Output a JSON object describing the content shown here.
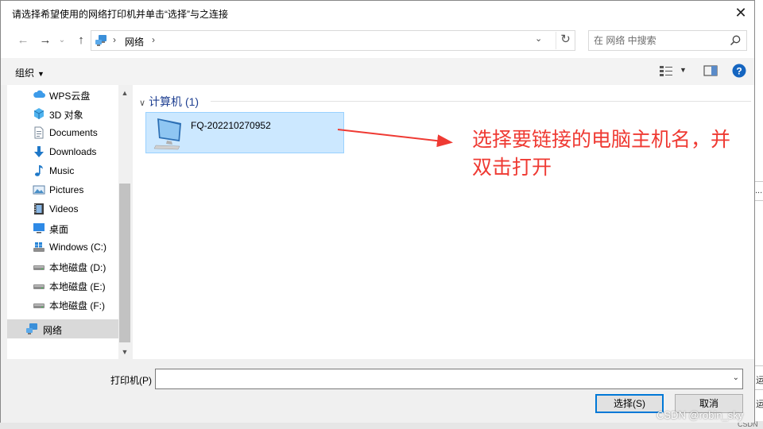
{
  "window": {
    "title": "请选择希望使用的网络打印机并单击“选择”与之连接"
  },
  "address": {
    "crumb": "网络"
  },
  "search": {
    "placeholder": "在 网络 中搜索"
  },
  "toolbar": {
    "organize": "组织"
  },
  "tree": {
    "items": [
      {
        "label": "WPS云盘",
        "icon": "cloud-icon"
      },
      {
        "label": "3D 对象",
        "icon": "3d-objects-icon"
      },
      {
        "label": "Documents",
        "icon": "document-icon"
      },
      {
        "label": "Downloads",
        "icon": "download-icon"
      },
      {
        "label": "Music",
        "icon": "music-icon"
      },
      {
        "label": "Pictures",
        "icon": "pictures-icon"
      },
      {
        "label": "Videos",
        "icon": "videos-icon"
      },
      {
        "label": "桌面",
        "icon": "desktop-icon"
      },
      {
        "label": "Windows (C:)",
        "icon": "windows-drive-icon"
      },
      {
        "label": "本地磁盘 (D:)",
        "icon": "drive-icon"
      },
      {
        "label": "本地磁盘 (E:)",
        "icon": "drive-icon"
      },
      {
        "label": "本地磁盘 (F:)",
        "icon": "drive-icon"
      },
      {
        "label": "网络",
        "icon": "network-icon",
        "selected": true
      }
    ]
  },
  "content": {
    "group_header": "计算机 (1)",
    "computer_name": "FQ-202210270952"
  },
  "annotation": {
    "line1": "选择要链接的电脑主机名，并",
    "line2": "双击打开",
    "color": "#ef3a33"
  },
  "bottom": {
    "printer_label": "打印机(P)",
    "printer_value": "",
    "select_button": "选择(S)",
    "cancel_button": "取消"
  },
  "background": {
    "fragment_top": "...",
    "fragment_mid": "运",
    "fragment_bottom": "运",
    "fragment_corner": "CSDN",
    "watermark": "CSDN @robin_sky"
  },
  "colors": {
    "selection": "#cce8ff",
    "accent": "#0078d7",
    "group_header": "#1e3f91"
  }
}
